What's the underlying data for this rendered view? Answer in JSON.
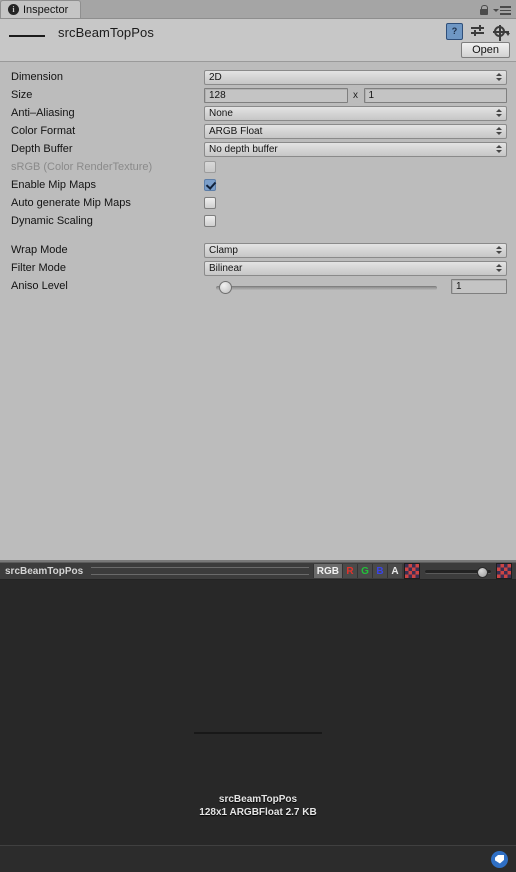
{
  "window": {
    "tab_label": "Inspector",
    "tab_icon": "info-icon",
    "lock_icon": "lock-icon",
    "menu_icon": "hamburger-menu-icon"
  },
  "asset": {
    "name": "srcBeamTopPos",
    "open_button": "Open",
    "help_icon": "?",
    "preset_icon": "preset-icon",
    "gear_icon": "gear-icon"
  },
  "properties": {
    "dimension": {
      "label": "Dimension",
      "value": "2D"
    },
    "size": {
      "label": "Size",
      "width": "128",
      "separator": "x",
      "height": "1"
    },
    "anti_aliasing": {
      "label": "Anti–Aliasing",
      "value": "None"
    },
    "color_format": {
      "label": "Color Format",
      "value": "ARGB Float"
    },
    "depth_buffer": {
      "label": "Depth Buffer",
      "value": "No depth buffer"
    },
    "srgb": {
      "label": "sRGB (Color RenderTexture)",
      "checked": false,
      "disabled": true
    },
    "enable_mip_maps": {
      "label": "Enable Mip Maps",
      "checked": true
    },
    "auto_generate_mip_maps": {
      "label": "Auto generate Mip Maps",
      "checked": false
    },
    "dynamic_scaling": {
      "label": "Dynamic Scaling",
      "checked": false
    },
    "wrap_mode": {
      "label": "Wrap Mode",
      "value": "Clamp"
    },
    "filter_mode": {
      "label": "Filter Mode",
      "value": "Bilinear"
    },
    "aniso_level": {
      "label": "Aniso Level",
      "value": "1"
    }
  },
  "preview": {
    "title": "srcBeamTopPos",
    "channels": {
      "rgb": "RGB",
      "r": "R",
      "g": "G",
      "b": "B",
      "a": "A"
    },
    "checker_icon_left": "checkerboard-icon",
    "checker_icon_right": "checkerboard-icon",
    "info_name": "srcBeamTopPos",
    "info_details": "128x1  ARGBFloat  2.7 KB"
  },
  "status": {
    "badge_icon": "tag-icon"
  }
}
